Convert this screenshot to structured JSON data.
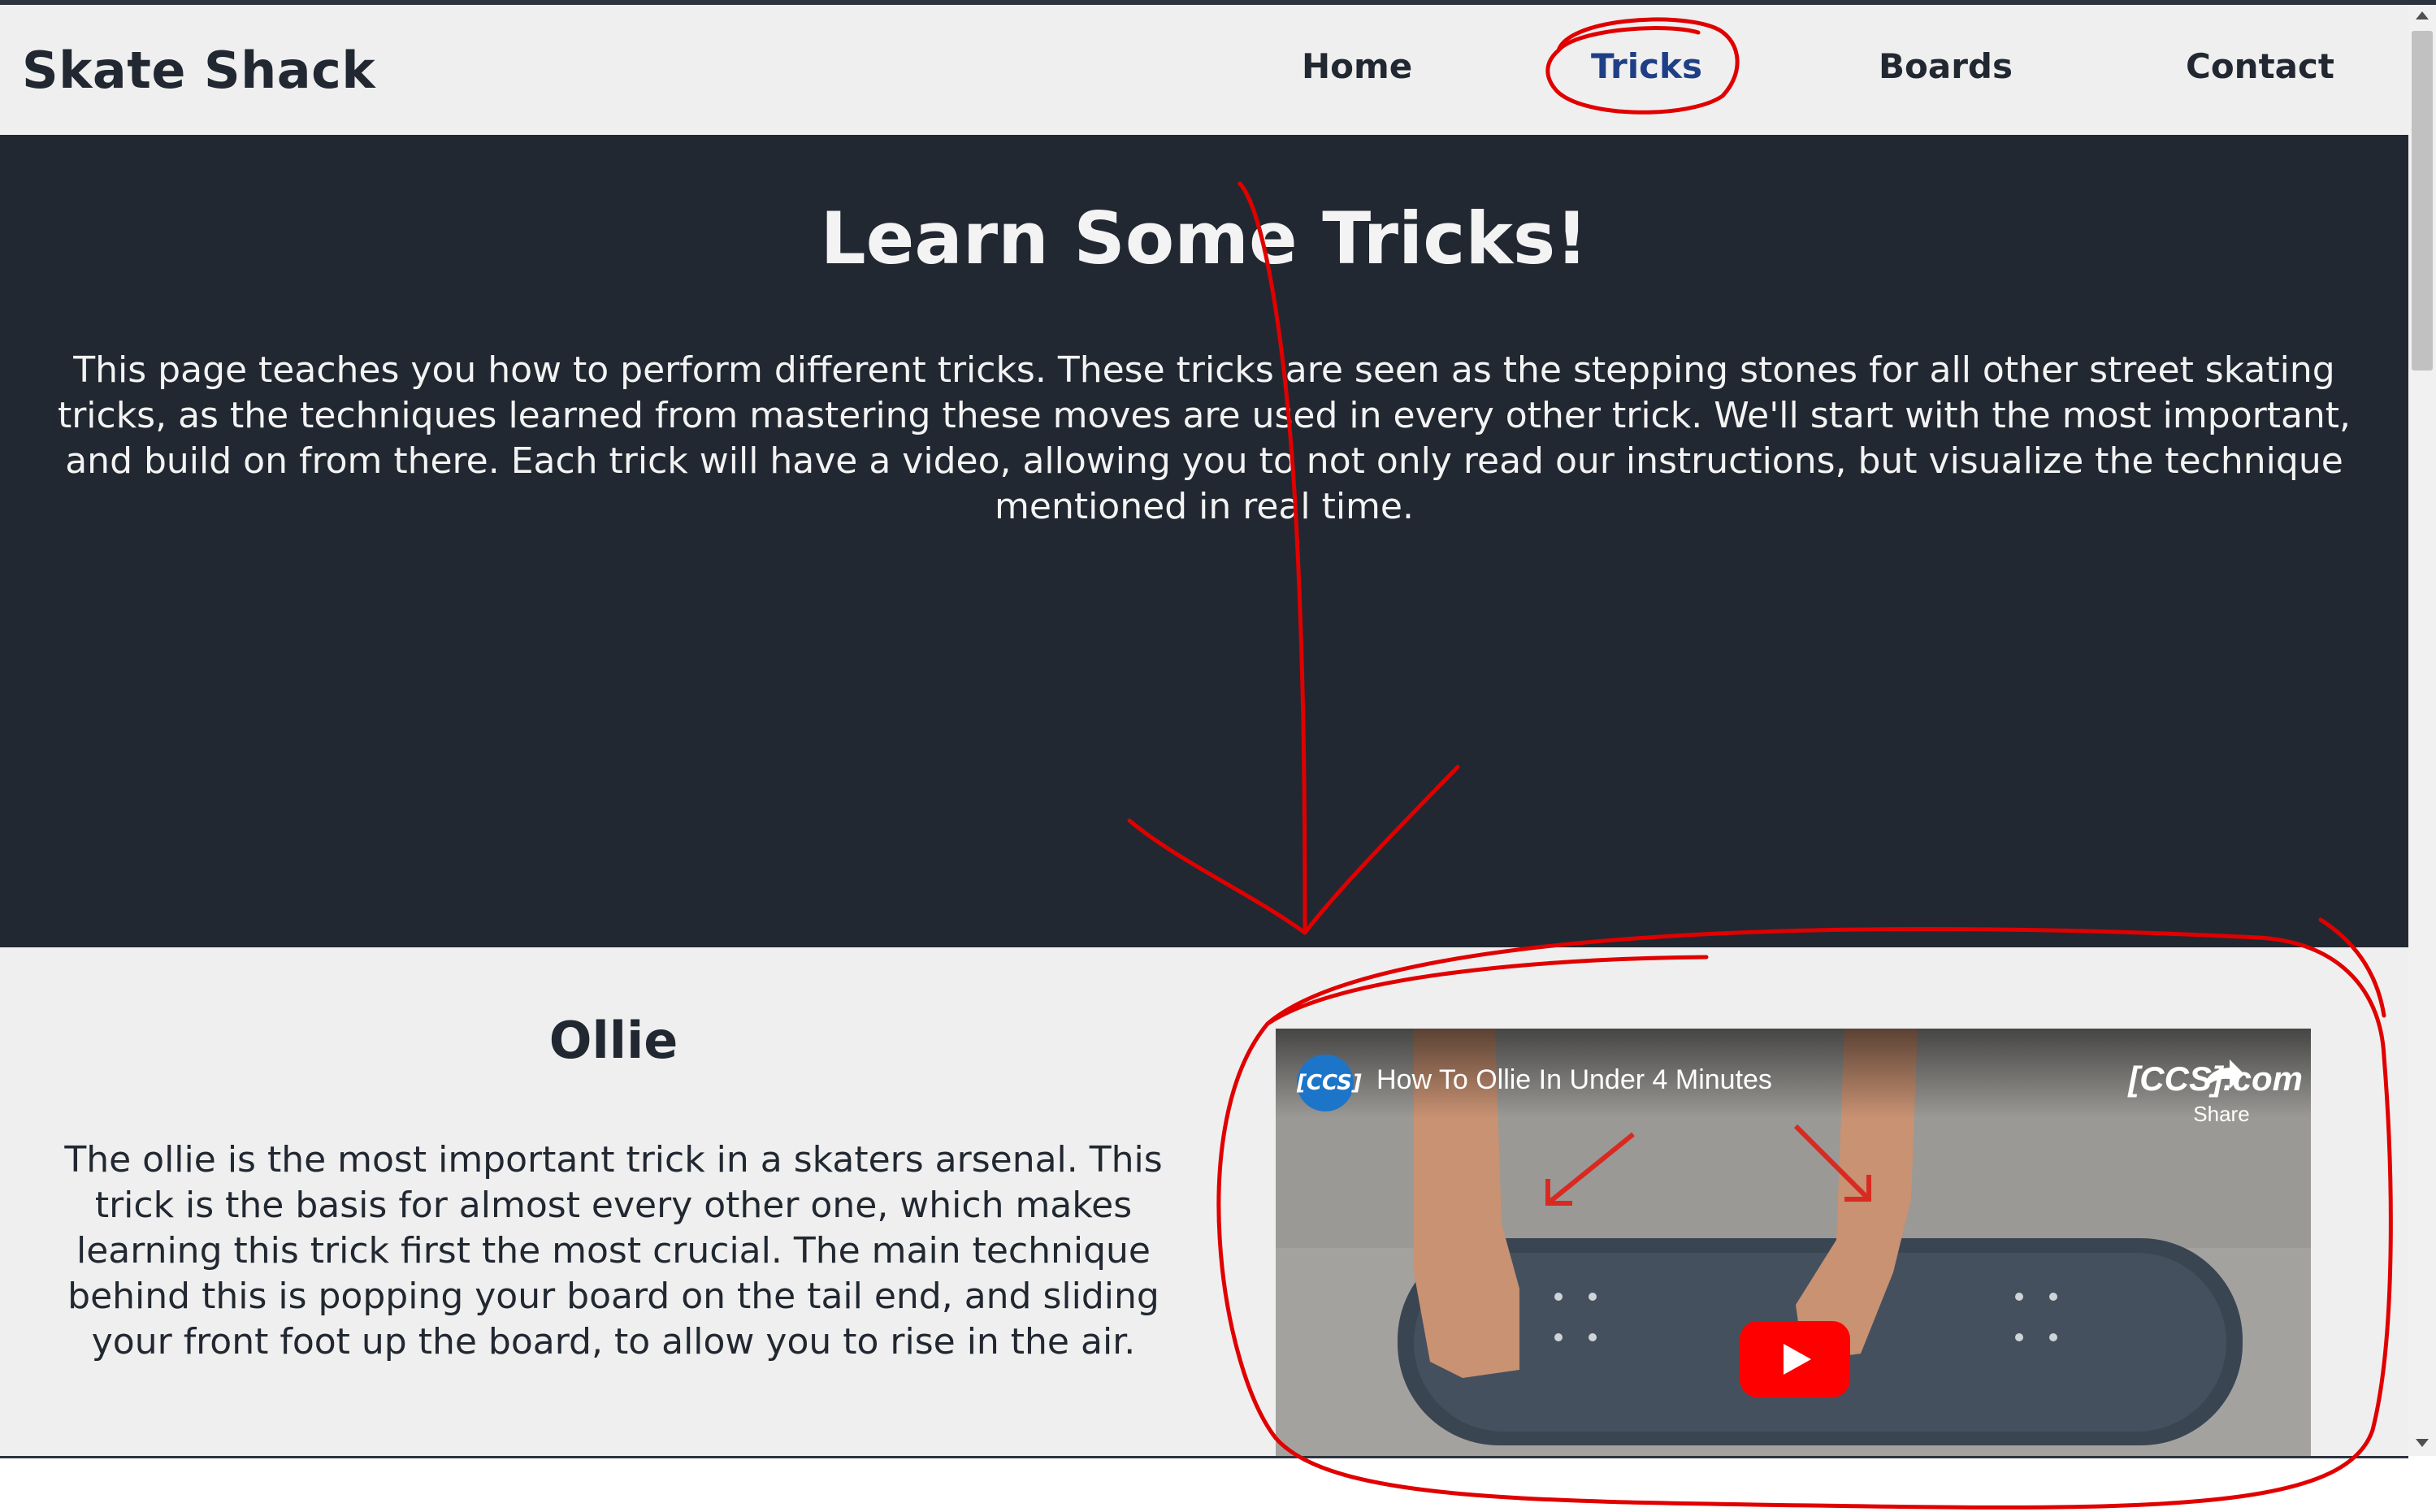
{
  "navbar": {
    "brand": "Skate Shack",
    "links": [
      {
        "label": "Home",
        "active": false
      },
      {
        "label": "Tricks",
        "active": true
      },
      {
        "label": "Boards",
        "active": false
      },
      {
        "label": "Contact",
        "active": false
      }
    ]
  },
  "hero": {
    "title": "Learn Some Tricks!",
    "text": "This page teaches you how to perform different tricks. These tricks are seen as the stepping stones for all other street skating tricks, as the techniques learned from mastering these moves are used in every other trick. We'll start with the most important, and build on from there. Each trick will have a video, allowing you to not only read our instructions, but visualize the technique mentioned in real time."
  },
  "trick": {
    "title": "Ollie",
    "text": "The ollie is the most important trick in a skaters arsenal. This trick is the basis for almost every other one, which makes learning this trick first the most crucial. The main technique behind this is popping your board on the tail end, and sliding your front foot up the board, to allow you to rise in the air.",
    "video": {
      "title": "How To Ollie In Under 4 Minutes",
      "channel_logo": "[CCS]",
      "watermark": "[CCS].com",
      "share_label": "Share"
    }
  },
  "colors": {
    "navbar_bg": "#efefef",
    "hero_bg": "#222831",
    "active_link": "#1e3f86",
    "annotation_red": "#e00000",
    "play_button": "#ff0000"
  }
}
